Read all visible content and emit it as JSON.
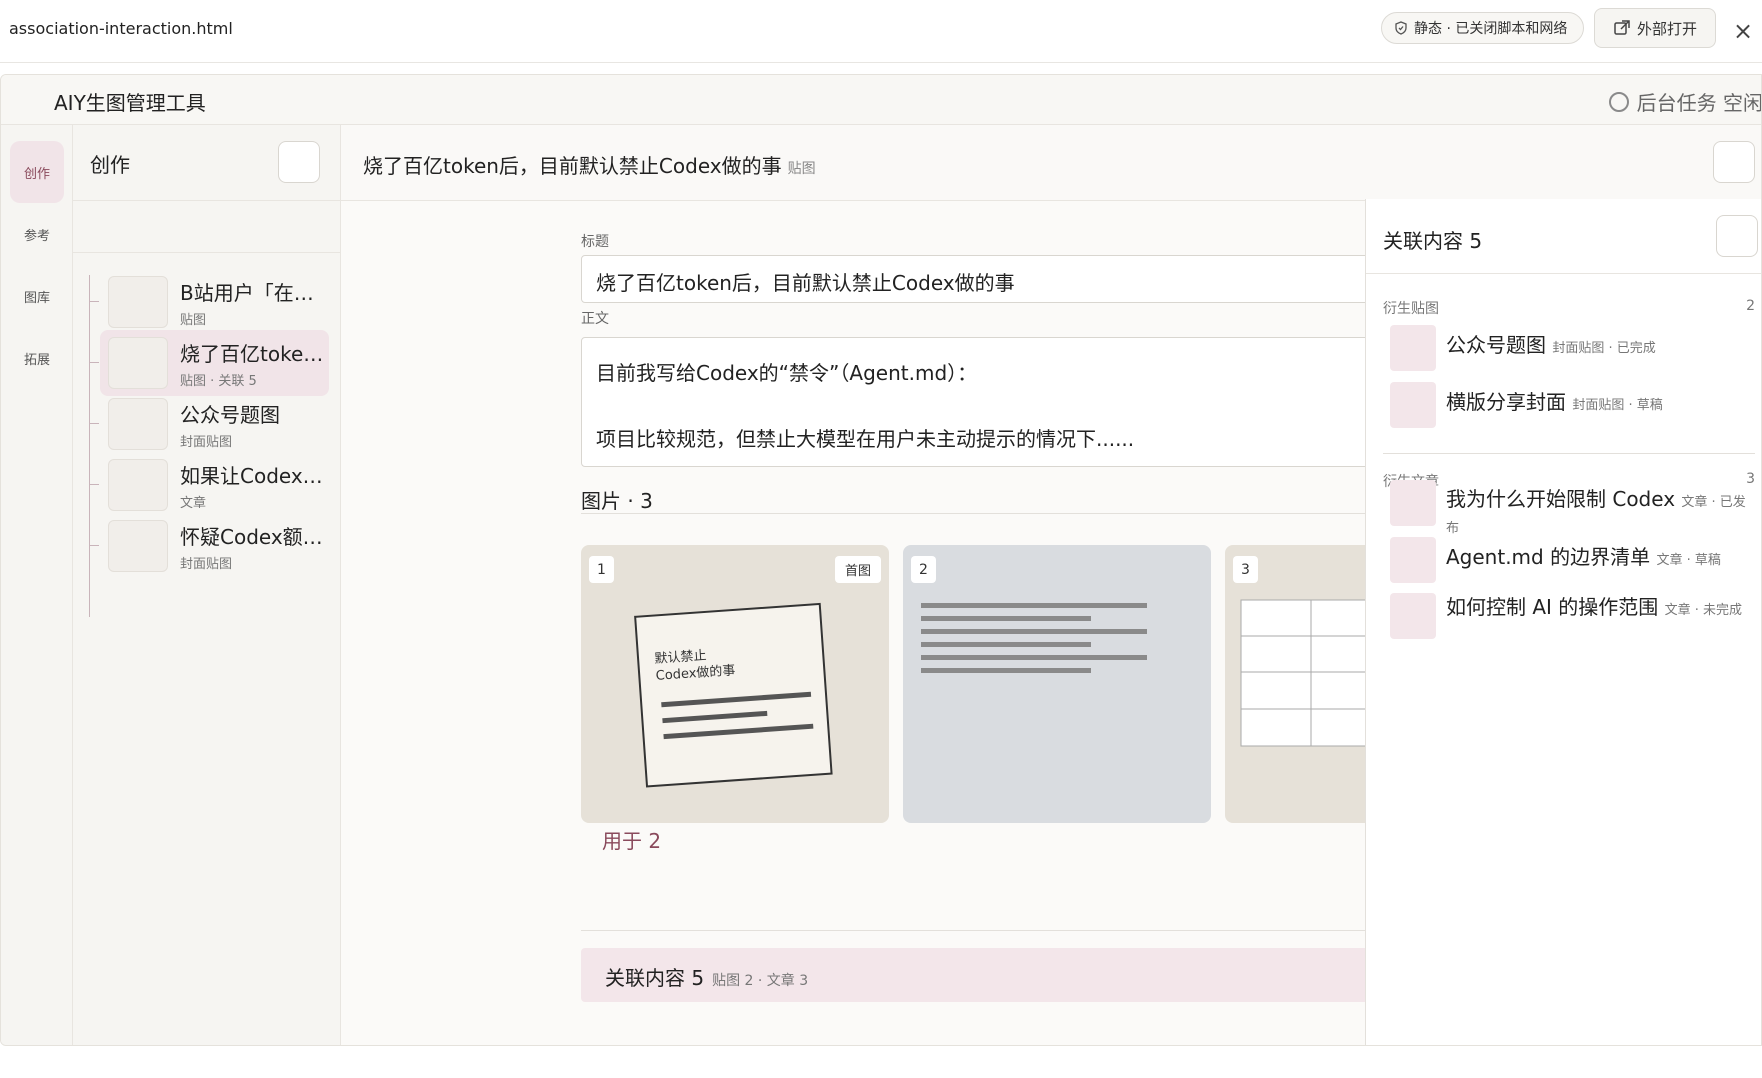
{
  "preview": {
    "filename": "association-interaction.html",
    "static_label": "静态 · 已关闭脚本和网络",
    "open_external_label": "外部打开",
    "close_glyph": "×"
  },
  "app": {
    "title": "AIY生图管理工具",
    "status": "后台任务 空闲"
  },
  "rail": {
    "items": [
      {
        "label": "创作",
        "active": true
      },
      {
        "label": "参考"
      },
      {
        "label": "图库"
      },
      {
        "label": "拓展"
      }
    ]
  },
  "side": {
    "header": "创作",
    "items": [
      {
        "name": "B站用户「在…",
        "meta": "贴图"
      },
      {
        "name": "烧了百亿toke…",
        "meta": "贴图 · 关联 5",
        "active": true
      },
      {
        "name": "公众号题图",
        "meta": "封面贴图"
      },
      {
        "name": "如果让Codex…",
        "meta": "文章"
      },
      {
        "name": "怀疑Codex额…",
        "meta": "封面贴图"
      }
    ]
  },
  "main": {
    "title": "烧了百亿token后，目前默认禁止Codex做的事",
    "title_tag": "贴图",
    "title_label": "标题",
    "title_value": "烧了百亿token后，目前默认禁止Codex做的事",
    "body_label": "正文",
    "body_line1": "目前我写给Codex的“禁令”（Agent.md）：",
    "body_line2": "项目比较规范，但禁止大模型在用户未主动提示的情况下......",
    "images_title": "图片 · 3",
    "cards": [
      {
        "num": "1",
        "badge": "首图",
        "text_line1": "默认禁止",
        "text_line2": "Codex做的事"
      },
      {
        "num": "2"
      },
      {
        "num": "3"
      }
    ],
    "used_label": "用于 2",
    "assoc_title": "关联内容 5",
    "assoc_meta": "贴图 2 · 文章 3"
  },
  "panel": {
    "title": "关联内容 5",
    "groups": [
      {
        "label": "衍生贴图",
        "count": "2",
        "items": [
          {
            "name": "公众号题图",
            "meta": "封面贴图 · 已完成"
          },
          {
            "name": "横版分享封面",
            "meta": "封面贴图 · 草稿"
          }
        ]
      },
      {
        "label": "衍生文章",
        "count": "3",
        "items": [
          {
            "name": "我为什么开始限制 Codex",
            "meta": "文章 · 已发布"
          },
          {
            "name": "Agent.md 的边界清单",
            "meta": "文章 · 草稿"
          },
          {
            "name": "如何控制 AI 的操作范围",
            "meta": "文章 · 未完成"
          }
        ]
      }
    ]
  },
  "colors": {
    "accent": "#8a4a5c",
    "accent_bg": "#f1e4e8",
    "panel_thumb": "#f3e6ea"
  }
}
